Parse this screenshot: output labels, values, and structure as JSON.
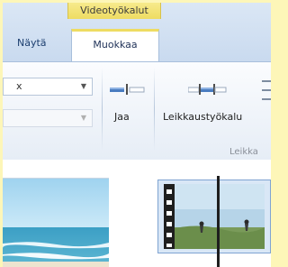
{
  "ribbon": {
    "contextual_header": "Videotyökalut",
    "tabs": [
      {
        "label": "Näytä",
        "active": false
      },
      {
        "label": "Muokkaa",
        "active": true
      }
    ],
    "dropdowns": [
      {
        "value": "x",
        "enabled": true
      },
      {
        "value": "",
        "enabled": false
      }
    ],
    "buttons": {
      "split_label": "Jaa",
      "trim_label": "Leikkaustyökalu",
      "third_label": "↓",
      "group_label": "Leikka"
    }
  },
  "icons": {
    "split": "split-icon",
    "trim": "trim-tool-icon",
    "dropdown_arrow": "chevron-down-icon"
  },
  "colors": {
    "context_tab": "#eedc62",
    "ribbon_blue": "#c9daef",
    "accent_blue": "#4a7cc0",
    "playhead": "#1e1e1e",
    "background": "#fdf6b8"
  }
}
